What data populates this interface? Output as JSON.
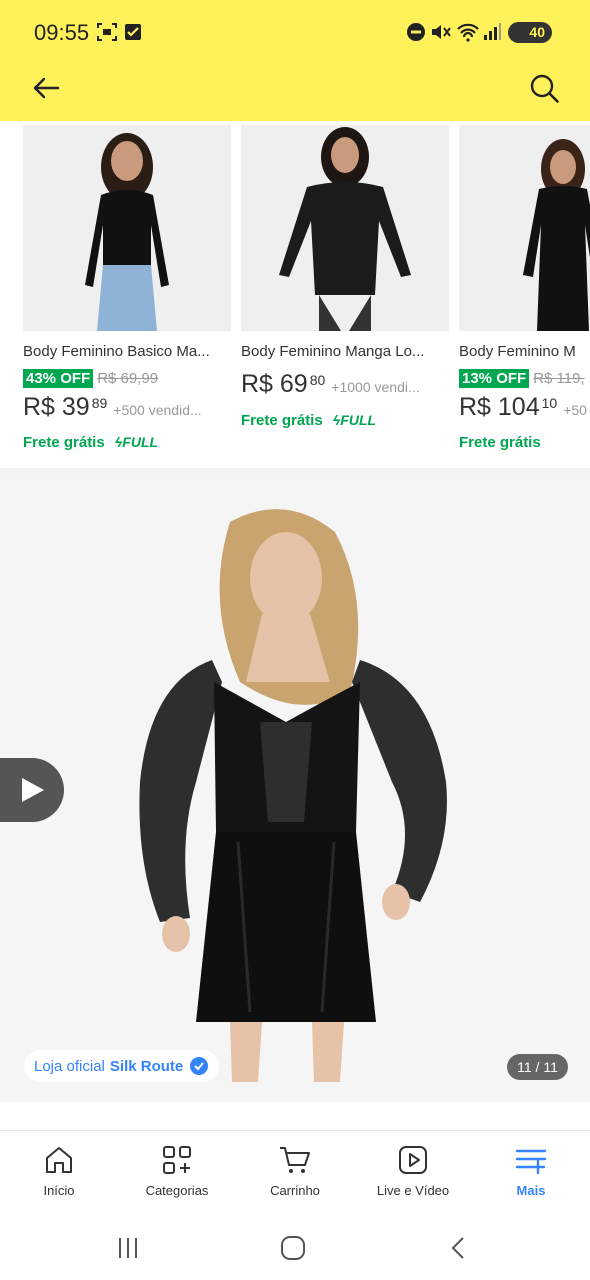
{
  "status_bar": {
    "time": "09:55",
    "battery": "40"
  },
  "header": {
    "back_icon": "arrow-left-icon",
    "search_icon": "search-icon"
  },
  "products": [
    {
      "title": "Body Feminino Basico Ma...",
      "discount": "43% OFF",
      "old_price": "R$ 69,99",
      "price": "R$ 39",
      "cents": "89",
      "sold": "+500 vendid...",
      "shipping": "Frete grátis",
      "full": "FULL"
    },
    {
      "title": "Body Feminino Manga Lo...",
      "discount": "",
      "old_price": "",
      "price": "R$ 69",
      "cents": "80",
      "sold": "+1000 vendi...",
      "shipping": "Frete grátis",
      "full": "FULL"
    },
    {
      "title": "Body Feminino M",
      "discount": "13% OFF",
      "old_price": "R$ 119,",
      "price": "R$ 104",
      "cents": "10",
      "sold": "+50",
      "shipping": "Frete grátis",
      "full": ""
    }
  ],
  "gallery": {
    "store_prefix": "Loja oficial",
    "store_name": "Silk Route",
    "counter": "11 / 11"
  },
  "bottom_nav": [
    {
      "label": "Início",
      "icon": "home-icon"
    },
    {
      "label": "Categorias",
      "icon": "categories-icon"
    },
    {
      "label": "Carrinho",
      "icon": "cart-icon"
    },
    {
      "label": "Live e Vídeo",
      "icon": "play-icon"
    },
    {
      "label": "Mais",
      "icon": "menu-plus-icon"
    }
  ],
  "colors": {
    "brand_yellow": "#fff159",
    "accent_blue": "#3483fa",
    "green": "#00a650"
  }
}
